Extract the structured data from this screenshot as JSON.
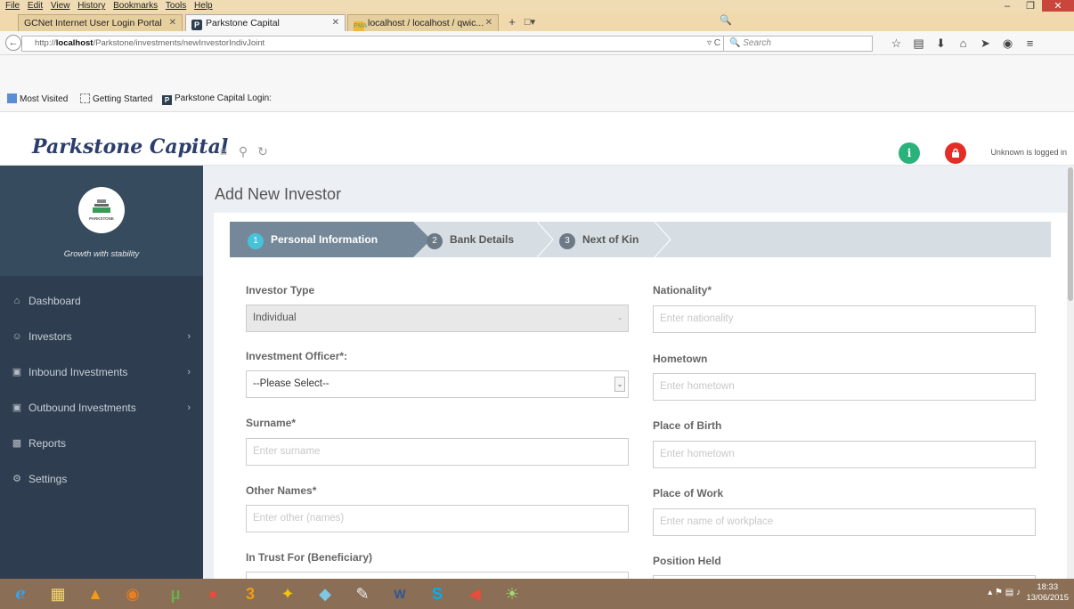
{
  "menubar": {
    "items": [
      "File",
      "Edit",
      "View",
      "History",
      "Bookmarks",
      "Tools",
      "Help"
    ],
    "minimize_icon": "minimize-icon",
    "maximize_icon": "maximize-icon",
    "close_icon": "close-icon"
  },
  "tabs": [
    {
      "title": "GCNet Internet User Login Portal"
    },
    {
      "title": "Parkstone Capital"
    },
    {
      "title": "localhost / localhost / qwic..."
    }
  ],
  "urlbar": {
    "prefix": "http://",
    "host": "localhost",
    "path": "/Parkstone/investments/newInvestorIndivJoint",
    "search_placeholder": "Search"
  },
  "bookmarks": [
    {
      "label": "Most Visited"
    },
    {
      "label": "Getting Started"
    },
    {
      "label": "Parkstone Capital Login:"
    }
  ],
  "header": {
    "logo": "Parkstone Capital",
    "info_label": "i",
    "user_status": "Unknown is logged in"
  },
  "sidebar": {
    "tagline": "Growth with stability",
    "brand_text": "PARKSTONE",
    "items": [
      {
        "label": "Dashboard",
        "icon": "home-icon",
        "has_children": false
      },
      {
        "label": "Investors",
        "icon": "users-icon",
        "has_children": true
      },
      {
        "label": "Inbound Investments",
        "icon": "money-icon",
        "has_children": true
      },
      {
        "label": "Outbound Investments",
        "icon": "money-icon",
        "has_children": true
      },
      {
        "label": "Reports",
        "icon": "bar-chart-icon",
        "has_children": false
      },
      {
        "label": "Settings",
        "icon": "cogs-icon",
        "has_children": false
      }
    ]
  },
  "main": {
    "title": "Add New Investor",
    "steps": [
      {
        "num": "1",
        "label": "Personal Information",
        "active": true
      },
      {
        "num": "2",
        "label": "Bank Details",
        "active": false
      },
      {
        "num": "3",
        "label": "Next of Kin",
        "active": false
      }
    ],
    "left_fields": {
      "investor_type": {
        "label": "Investor Type",
        "value": "Individual"
      },
      "investment_officer": {
        "label": "Investment Officer*:",
        "value": "--Please Select--"
      },
      "surname": {
        "label": "Surname*",
        "placeholder": "Enter surname"
      },
      "other_names": {
        "label": "Other Names*",
        "placeholder": "Enter other (names)"
      },
      "in_trust_for": {
        "label": "In Trust For (Beneficiary)"
      }
    },
    "right_fields": {
      "nationality": {
        "label": "Nationality*",
        "placeholder": "Enter nationality"
      },
      "hometown": {
        "label": "Hometown",
        "placeholder": "Enter hometown"
      },
      "place_of_birth": {
        "label": "Place of Birth",
        "placeholder": "Enter hometown"
      },
      "place_of_work": {
        "label": "Place of Work",
        "placeholder": "Enter name of workplace"
      },
      "position_held": {
        "label": "Position Held"
      }
    }
  },
  "taskbar": {
    "time": "18:33",
    "date": "13/06/2015"
  }
}
